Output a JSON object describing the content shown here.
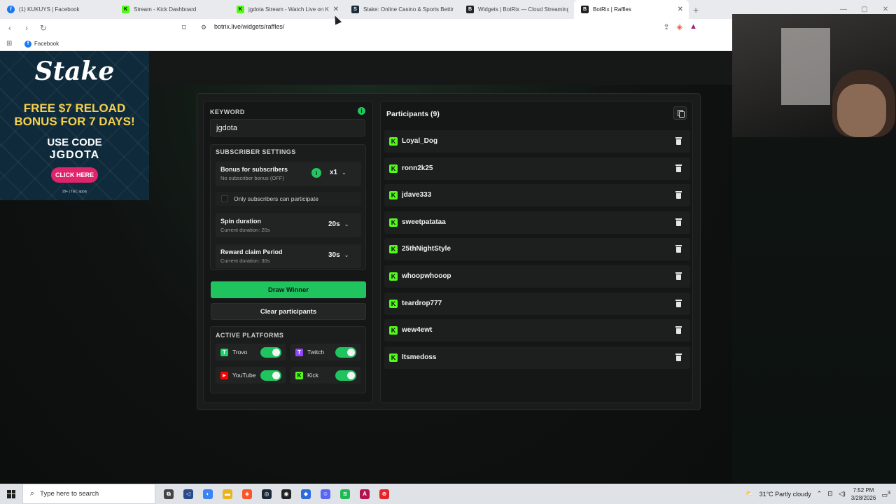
{
  "browser": {
    "tabs": [
      {
        "title": "(1) KUKUYS | Facebook",
        "favicon": "facebook-icon",
        "color": "#1877f2",
        "glyph": "f",
        "active": false
      },
      {
        "title": "Stream - Kick Dashboard",
        "favicon": "kick-icon",
        "color": "#53fc18",
        "glyph": "K",
        "active": false
      },
      {
        "title": "jgdota Stream - Watch Live on K",
        "favicon": "kick-icon",
        "color": "#53fc18",
        "glyph": "K",
        "active": false
      },
      {
        "title": "Stake: Online Casino & Sports Betting",
        "favicon": "stake-icon",
        "color": "#1a2c38",
        "glyph": "S",
        "active": false
      },
      {
        "title": "Widgets | BotRix — Cloud Streaming",
        "favicon": "botrix-icon",
        "color": "#222222",
        "glyph": "B",
        "active": false
      },
      {
        "title": "BotRix | Raffles",
        "favicon": "botrix-icon",
        "color": "#222222",
        "glyph": "B",
        "active": true
      }
    ],
    "url": "botrix.live/widgets/raffles/",
    "bookmarks": [
      {
        "label": "Facebook",
        "icon": "facebook-icon"
      }
    ]
  },
  "ad": {
    "logo": "Stake",
    "line1": "FREE $7 RELOAD",
    "line2": "BONUS FOR 7 DAYS!",
    "code_line1": "USE CODE",
    "code_line2": "JGDOTA",
    "button": "CLICK HERE",
    "fine_print": "18+ | T&C apply"
  },
  "raffle": {
    "keyword_label": "KEYWORD",
    "keyword_value": "jgdota",
    "subscriber_settings_label": "SUBSCRIBER SETTINGS",
    "bonus": {
      "name": "Bonus for subscribers",
      "sub": "No subscriber bonus (OFF)",
      "value": "x1"
    },
    "only_subscribers_label": "Only subscribers can participate",
    "spin": {
      "name": "Spin duration",
      "sub": "Current duration: 20s",
      "value": "20s"
    },
    "claim": {
      "name": "Reward claim Period",
      "sub": "Current duration: 30s",
      "value": "30s"
    },
    "draw_button": "Draw Winner",
    "clear_button": "Clear participants",
    "platforms_label": "ACTIVE PLATFORMS",
    "platforms": [
      {
        "name": "Trovo",
        "icon": "trovo-icon",
        "color": "#19d66b",
        "glyph": "T",
        "enabled": true
      },
      {
        "name": "Twitch",
        "icon": "twitch-icon",
        "color": "#9146ff",
        "glyph": "T",
        "enabled": true
      },
      {
        "name": "YouTube",
        "icon": "youtube-icon",
        "color": "#ff0000",
        "glyph": "▶",
        "enabled": true
      },
      {
        "name": "Kick",
        "icon": "kick-icon",
        "color": "#53fc18",
        "glyph": "K",
        "enabled": true
      }
    ],
    "participants_title": "Participants (9)",
    "participants": [
      "Loyal_Dog",
      "ronn2k25",
      "jdave333",
      "sweetpatataa",
      "25thNightStyle",
      "whoopwhooop",
      "teardrop777",
      "wew4ewt",
      "Itsmedoss"
    ]
  },
  "taskbar": {
    "search_placeholder": "Type here to search",
    "weather": "31°C  Partly cloudy",
    "time": "7:52 PM",
    "date": "3/28/2026",
    "notification_count": "3"
  },
  "colors": {
    "accent": "#1fc45e",
    "kick": "#53fc18",
    "panel": "#1a1c1c"
  }
}
